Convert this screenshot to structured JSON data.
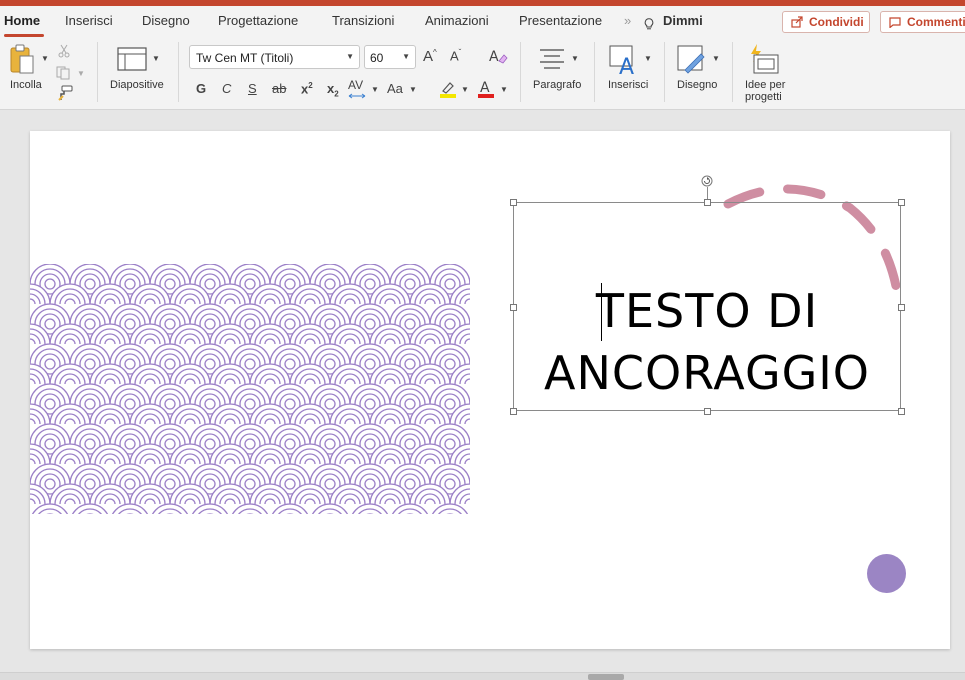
{
  "tabs": [
    {
      "label": "Home",
      "active": true
    },
    {
      "label": "Inserisci"
    },
    {
      "label": "Disegno"
    },
    {
      "label": "Progettazione"
    },
    {
      "label": "Transizioni"
    },
    {
      "label": "Animazioni"
    },
    {
      "label": "Presentazione"
    }
  ],
  "tell_me": "Dimmi",
  "buttons": {
    "share": "Condividi",
    "comments": "Commenti"
  },
  "ribbon": {
    "paste": "Incolla",
    "slides": "Diapositive",
    "font_name": "Tw Cen MT (Titoli)",
    "font_size": "60",
    "bold": "G",
    "italic": "C",
    "underline": "S",
    "strike": "ab",
    "superscript": "x",
    "subscript": "x",
    "spacing": "AV",
    "case": "Aa",
    "paragraph": "Paragrafo",
    "insert": "Inserisci",
    "drawing": "Disegno",
    "designer_line1": "Idee per",
    "designer_line2": "progetti"
  },
  "slide": {
    "line1": "TESTO DI",
    "line2": "ANCORAGGIO"
  },
  "colors": {
    "accent": "#c4462e",
    "pattern": "#9b7fc7",
    "arc": "#cf8ea2",
    "dot": "#9b85c4",
    "highlight": "#f3e600",
    "font_color": "#e0201e"
  }
}
